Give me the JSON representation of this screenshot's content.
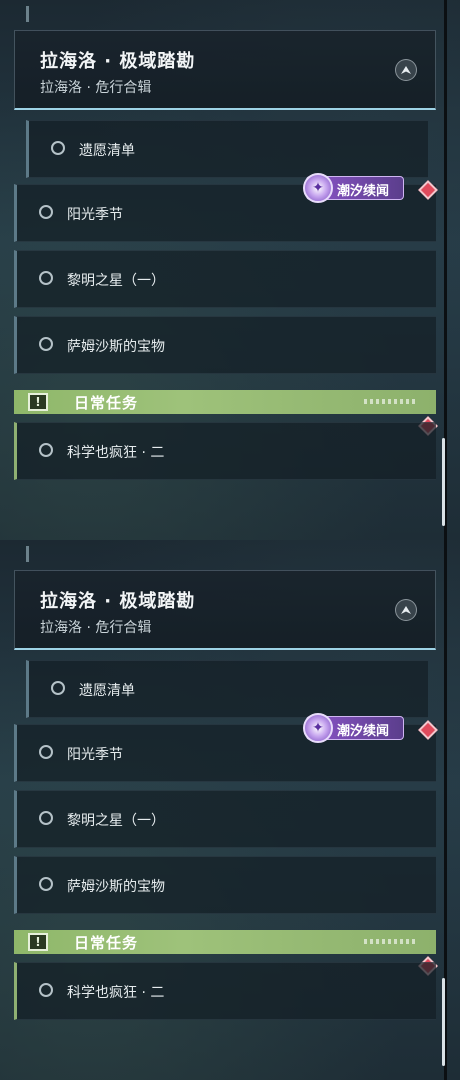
{
  "quest_header": {
    "title": "拉海洛 · 极域踏勘",
    "subtitle": "拉海洛 · 危行合辑"
  },
  "quests": [
    {
      "label": "遗愿清单"
    },
    {
      "label": "阳光季节"
    },
    {
      "label": "黎明之星（一）"
    },
    {
      "label": "萨姆沙斯的宝物"
    }
  ],
  "event_badge": {
    "label": "潮汐续闻",
    "icon": "tide-event-icon",
    "color": "#8a54c8"
  },
  "daily": {
    "title": "日常任务",
    "icon": "alert-icon",
    "quests": [
      {
        "label": "科学也疯狂 · 二"
      }
    ],
    "color": "#8fb76a"
  },
  "marker_color": "#e04a5c"
}
